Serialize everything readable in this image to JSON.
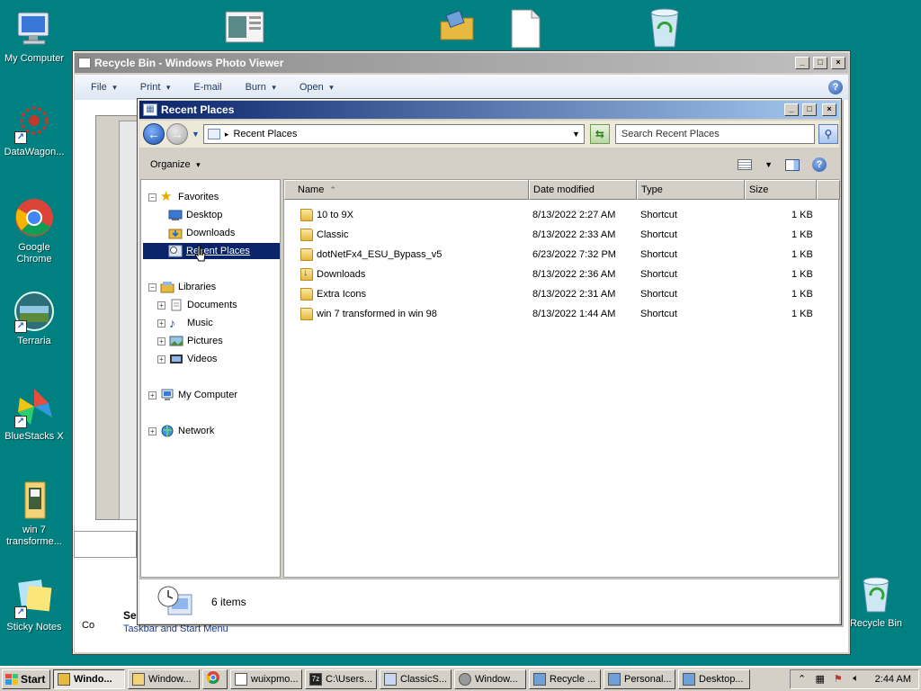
{
  "desktop": {
    "icons": [
      {
        "label": "My Computer",
        "icon": "my-computer-icon"
      },
      {
        "label": "DataWagon...",
        "icon": "datawagon-icon"
      },
      {
        "label": "Google Chrome",
        "icon": "chrome-icon"
      },
      {
        "label": "Terraria",
        "icon": "terraria-icon"
      },
      {
        "label": "BlueStacks X",
        "icon": "bluestacks-icon"
      },
      {
        "label": "win 7 transforme...",
        "icon": "folder-icon"
      },
      {
        "label": "Sticky Notes",
        "icon": "sticky-notes-icon"
      },
      {
        "label": "Recycle Bin",
        "icon": "recycle-bin-icon"
      }
    ]
  },
  "photo_viewer": {
    "title": "Recycle Bin - Windows Photo Viewer",
    "menu": [
      "File",
      "Print",
      "E-mail",
      "Burn",
      "Open"
    ],
    "bottom_heading": "Se",
    "bottom_link": "Taskbar and Start Menu",
    "side_text": "Co"
  },
  "explorer": {
    "title": "Recent Places",
    "address": "Recent Places",
    "search_placeholder": "Search Recent Places",
    "organize_label": "Organize",
    "nav": {
      "favorites": "Favorites",
      "desktop": "Desktop",
      "downloads": "Downloads",
      "recent_places": "Recent Places",
      "libraries": "Libraries",
      "documents": "Documents",
      "music": "Music",
      "pictures": "Pictures",
      "videos": "Videos",
      "my_computer": "My Computer",
      "network": "Network"
    },
    "columns": {
      "name": "Name",
      "date": "Date modified",
      "type": "Type",
      "size": "Size"
    },
    "files": [
      {
        "name": "10 to 9X",
        "date": "8/13/2022 2:27 AM",
        "type": "Shortcut",
        "size": "1 KB"
      },
      {
        "name": "Classic",
        "date": "8/13/2022 2:33 AM",
        "type": "Shortcut",
        "size": "1 KB"
      },
      {
        "name": "dotNetFx4_ESU_Bypass_v5",
        "date": "6/23/2022 7:32 PM",
        "type": "Shortcut",
        "size": "1 KB"
      },
      {
        "name": "Downloads",
        "date": "8/13/2022 2:36 AM",
        "type": "Shortcut",
        "size": "1 KB"
      },
      {
        "name": "Extra Icons",
        "date": "8/13/2022 2:31 AM",
        "type": "Shortcut",
        "size": "1 KB"
      },
      {
        "name": "win 7 transformed in win 98",
        "date": "8/13/2022 1:44 AM",
        "type": "Shortcut",
        "size": "1 KB"
      }
    ],
    "status": "6 items"
  },
  "taskbar": {
    "start_label": "Start",
    "buttons": [
      {
        "label": "Windo...",
        "active": true
      },
      {
        "label": "Window...",
        "active": false
      },
      {
        "label": "",
        "active": false
      },
      {
        "label": "wuixpmo...",
        "active": false
      },
      {
        "label": "C:\\Users...",
        "active": false
      },
      {
        "label": "ClassicS...",
        "active": false
      },
      {
        "label": "Window...",
        "active": false
      },
      {
        "label": "Recycle ...",
        "active": false
      },
      {
        "label": "Personal...",
        "active": false
      },
      {
        "label": "Desktop...",
        "active": false
      }
    ],
    "clock": "2:44 AM"
  },
  "colors": {
    "desktop": "#008080",
    "active_title": "#0a246a",
    "selection": "#0a246a"
  }
}
